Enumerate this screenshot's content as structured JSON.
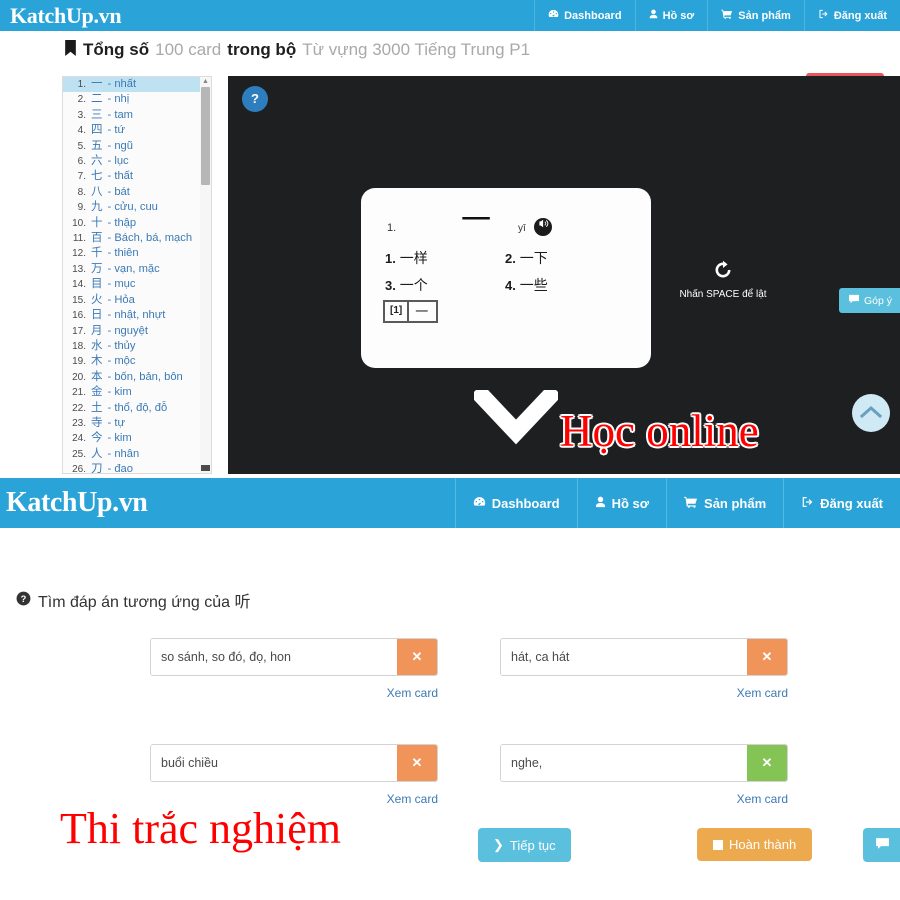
{
  "brand": "KatchUp.vn",
  "nav": {
    "items": [
      {
        "label": "Dashboard",
        "icon": "dashboard-icon",
        "glyph": "☲"
      },
      {
        "label": "Hồ sơ",
        "icon": "user-icon",
        "glyph": "♟"
      },
      {
        "label": "Sản phẩm",
        "icon": "cart-icon",
        "glyph": "Ὥ2"
      },
      {
        "label": "Đăng xuất",
        "icon": "sign-out-icon",
        "glyph": "⇥"
      }
    ]
  },
  "deck_header": {
    "bookmark_icon": "bookmark-icon",
    "label_total": "Tổng số",
    "count": "100 card",
    "label_in_set": "trong bộ",
    "set_name": "Từ vựng 3000 Tiếng Trung P1",
    "study_button": "Học Online"
  },
  "card_list": [
    {
      "num": "1.",
      "han": "一",
      "text": "- nhất",
      "selected": true
    },
    {
      "num": "2.",
      "han": "二",
      "text": "- nhị",
      "selected": false
    },
    {
      "num": "3.",
      "han": "三",
      "text": "- tam",
      "selected": false
    },
    {
      "num": "4.",
      "han": "四",
      "text": "- tứ",
      "selected": false
    },
    {
      "num": "5.",
      "han": "五",
      "text": "- ngũ",
      "selected": false
    },
    {
      "num": "6.",
      "han": "六",
      "text": "- lục",
      "selected": false
    },
    {
      "num": "7.",
      "han": "七",
      "text": "- thất",
      "selected": false
    },
    {
      "num": "8.",
      "han": "八",
      "text": "- bát",
      "selected": false
    },
    {
      "num": "9.",
      "han": "九",
      "text": "- cửu, cuu",
      "selected": false
    },
    {
      "num": "10.",
      "han": "十",
      "text": "- thập",
      "selected": false
    },
    {
      "num": "11.",
      "han": "百",
      "text": "- Bách, bá, mạch",
      "selected": false
    },
    {
      "num": "12.",
      "han": "千",
      "text": "- thiên",
      "selected": false
    },
    {
      "num": "13.",
      "han": "万",
      "text": "- vạn, mặc",
      "selected": false
    },
    {
      "num": "14.",
      "han": "目",
      "text": "- mục",
      "selected": false
    },
    {
      "num": "15.",
      "han": "火",
      "text": "- Hỏa",
      "selected": false
    },
    {
      "num": "16.",
      "han": "日",
      "text": "- nhật, nhựt",
      "selected": false
    },
    {
      "num": "17.",
      "han": "月",
      "text": "- nguyệt",
      "selected": false
    },
    {
      "num": "18.",
      "han": "水",
      "text": "- thủy",
      "selected": false
    },
    {
      "num": "19.",
      "han": "木",
      "text": "- mộc",
      "selected": false
    },
    {
      "num": "20.",
      "han": "本",
      "text": "- bốn, bản, bôn",
      "selected": false
    },
    {
      "num": "21.",
      "han": "金",
      "text": "- kim",
      "selected": false
    },
    {
      "num": "22.",
      "han": "土",
      "text": "- thổ, độ, đỗ",
      "selected": false
    },
    {
      "num": "23.",
      "han": "寺",
      "text": "- tự",
      "selected": false
    },
    {
      "num": "24.",
      "han": "今",
      "text": "- kim",
      "selected": false
    },
    {
      "num": "25.",
      "han": "人",
      "text": "- nhân",
      "selected": false
    },
    {
      "num": "26.",
      "han": "刀",
      "text": "- đao",
      "selected": false
    }
  ],
  "flashcard": {
    "help_button": "?",
    "question_number": "1.",
    "character": "一",
    "pinyin": "yī",
    "speaker_icon": "speaker-icon",
    "options": [
      {
        "num": "1.",
        "text": "一样"
      },
      {
        "num": "2.",
        "text": "一下"
      },
      {
        "num": "3.",
        "text": "一个"
      },
      {
        "num": "4.",
        "text": "一些"
      }
    ],
    "stroke_index": "[1]",
    "stroke_glyph": "一",
    "flip_icon": "refresh-icon",
    "flip_text": "Nhấn SPACE để lật",
    "scroll_hint_icon": "chevron-down-icon"
  },
  "overlays": {
    "top": "Học online",
    "bottom": "Thi trắc nghiệm"
  },
  "feedback_tab": {
    "label": "Góp ý",
    "icon": "comment-icon"
  },
  "scroll_top_button": {
    "icon": "chevron-up-icon"
  },
  "quiz": {
    "icon": "question-circle-icon",
    "prompt": "Tìm đáp án tương ứng của 听",
    "view_card_label": "Xem card",
    "clear_icon": "close-icon",
    "answers": [
      {
        "value": "so sánh, so đó, đọ, hon",
        "state": "orange"
      },
      {
        "value": "hát, ca hát",
        "state": "orange"
      },
      {
        "value": "buổi chiều",
        "state": "orange"
      },
      {
        "value": "nghe,",
        "state": "green"
      }
    ],
    "continue_button": "Tiếp tục",
    "continue_icon": "chevron-right-icon",
    "finish_button": "Hoàn thành",
    "finish_icon": "stop-square-icon"
  },
  "colors": {
    "brand_blue": "#2aa3d8",
    "red_button": "#e8555f",
    "orange": "#f0945a",
    "green": "#84c454",
    "amber": "#eca94e",
    "light_blue": "#5bc0de",
    "dark_panel": "#1d1f21",
    "overlay_red": "#ff0000"
  }
}
